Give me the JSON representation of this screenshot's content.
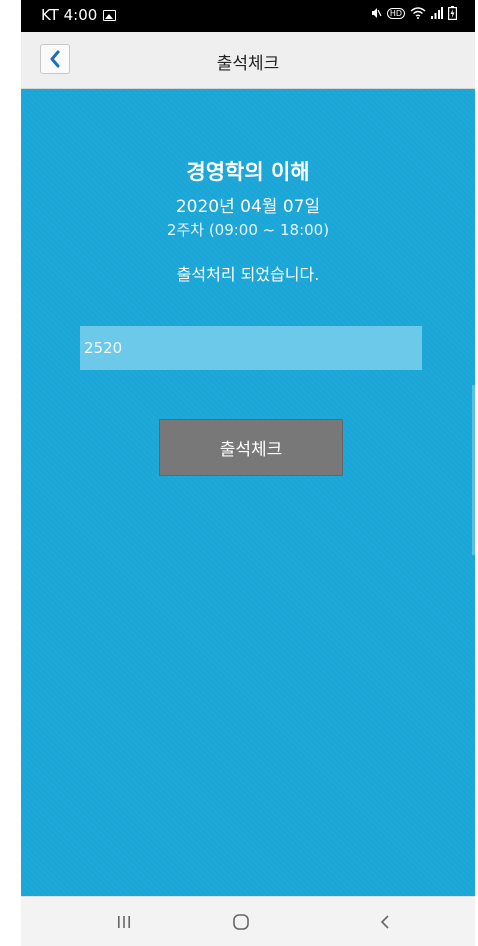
{
  "status_bar": {
    "carrier_time": "KT 4:00",
    "gallery_icon": "image-icon",
    "right_icons": [
      "mute-icon",
      "hd-icon",
      "wifi-icon",
      "signal-icon",
      "battery-icon"
    ],
    "hd_label": "HD"
  },
  "app_bar": {
    "back_icon": "chevron-left-icon",
    "title": "출석체크"
  },
  "main": {
    "course_name": "경영학의 이해",
    "date": "2020년 04월 07일",
    "week_time": "2주차 (09:00 ~ 18:00)",
    "message": "출석처리 되었습니다.",
    "code_value": "2520",
    "check_button_label": "출석체크"
  },
  "nav_bar": {
    "recent_apps_icon": "recent-apps-icon",
    "home_icon": "home-icon",
    "back_icon": "back-icon"
  },
  "colors": {
    "background": "#1aa6d7",
    "app_bar": "#efefef",
    "input": "#6cc9e9",
    "button": "#787878",
    "accent": "#1c6fb8"
  }
}
